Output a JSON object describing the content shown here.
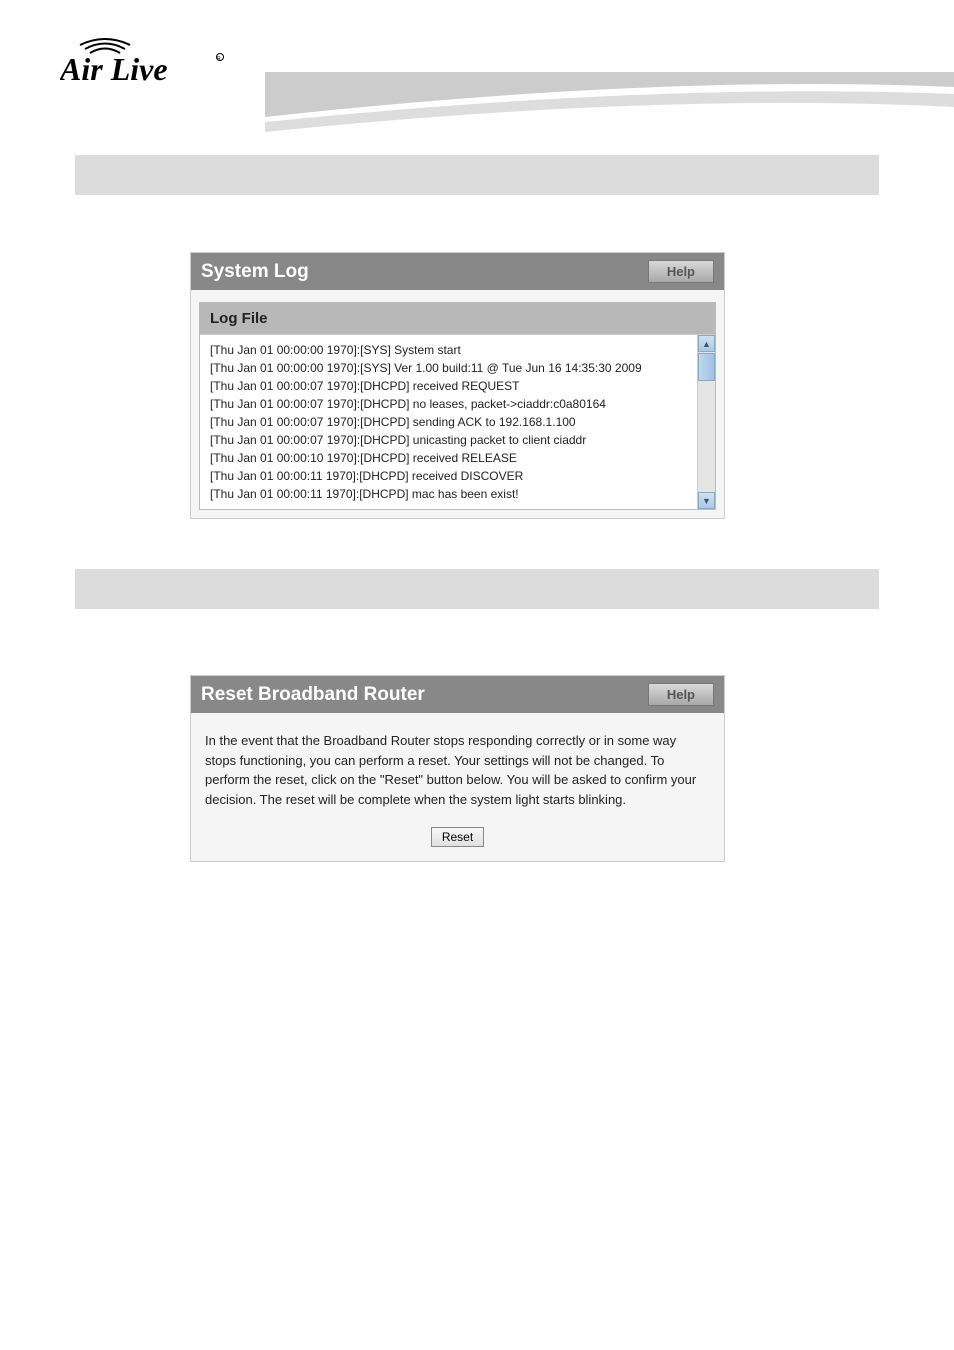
{
  "panel1": {
    "title": "System Log",
    "help": "Help",
    "log_header": "Log File",
    "lines": [
      "[Thu Jan 01 00:00:00 1970]:[SYS] System start",
      "[Thu Jan 01 00:00:00 1970]:[SYS] Ver 1.00 build:11 @ Tue Jun 16 14:35:30 2009",
      "[Thu Jan 01 00:00:07 1970]:[DHCPD] received REQUEST",
      "[Thu Jan 01 00:00:07 1970]:[DHCPD] no leases, packet->ciaddr:c0a80164",
      "[Thu Jan 01 00:00:07 1970]:[DHCPD] sending ACK to 192.168.1.100",
      "[Thu Jan 01 00:00:07 1970]:[DHCPD] unicasting packet to client ciaddr",
      "[Thu Jan 01 00:00:10 1970]:[DHCPD] received RELEASE",
      "[Thu Jan 01 00:00:11 1970]:[DHCPD] received DISCOVER",
      "[Thu Jan 01 00:00:11 1970]:[DHCPD] mac has been exist!"
    ]
  },
  "panel2": {
    "title": "Reset Broadband Router",
    "help": "Help",
    "body": "In the event that the Broadband Router stops responding correctly or in some way stops functioning, you can perform a reset. Your settings will not be changed. To perform the reset, click on the \"Reset\" button below. You will be asked to confirm your decision. The reset will be complete when the system light starts blinking.",
    "reset": "Reset"
  }
}
